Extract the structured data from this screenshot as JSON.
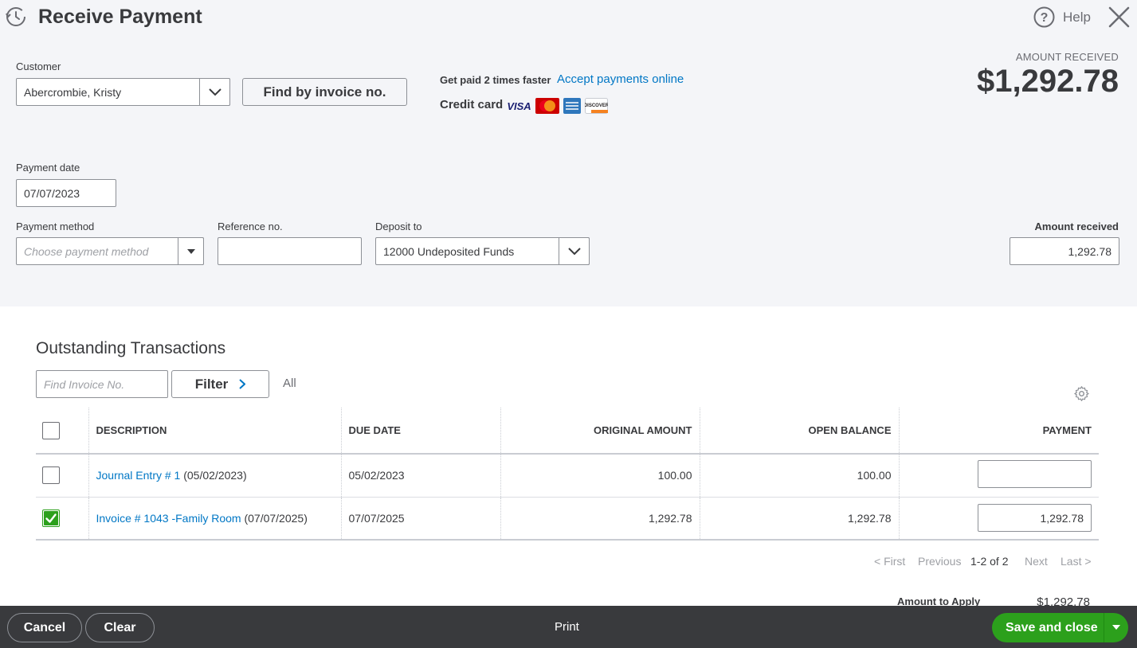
{
  "header": {
    "title": "Receive Payment",
    "help_label": "Help"
  },
  "customer": {
    "label": "Customer",
    "value": "Abercrombie, Kristy",
    "find_button": "Find by invoice no."
  },
  "promo": {
    "text": "Get paid 2 times faster",
    "link": "Accept payments online",
    "credit_label": "Credit card",
    "cards": [
      "visa-icon",
      "mastercard-icon",
      "amex-icon",
      "discover-icon"
    ]
  },
  "amount_received_banner": {
    "caption": "AMOUNT RECEIVED",
    "value": "$1,292.78"
  },
  "payment_date": {
    "label": "Payment date",
    "value": "07/07/2023"
  },
  "payment_method": {
    "label": "Payment method",
    "placeholder": "Choose payment method"
  },
  "reference": {
    "label": "Reference no.",
    "value": ""
  },
  "deposit_to": {
    "label": "Deposit to",
    "value": "12000 Undeposited Funds"
  },
  "amount_received_field": {
    "label": "Amount received",
    "value": "1,292.78"
  },
  "outstanding": {
    "title": "Outstanding Transactions",
    "search_placeholder": "Find Invoice No.",
    "filter_label": "Filter",
    "filter_value": "All",
    "columns": [
      "DESCRIPTION",
      "DUE DATE",
      "ORIGINAL AMOUNT",
      "OPEN BALANCE",
      "PAYMENT"
    ],
    "rows": [
      {
        "checked": false,
        "link": "Journal Entry # 1",
        "suffix": " (05/02/2023)",
        "due_date": "05/02/2023",
        "original": "100.00",
        "open": "100.00",
        "payment": ""
      },
      {
        "checked": true,
        "link": "Invoice # 1043 -Family Room",
        "suffix": " (07/07/2025)",
        "due_date": "07/07/2025",
        "original": "1,292.78",
        "open": "1,292.78",
        "payment": "1,292.78"
      }
    ],
    "pager": {
      "first": "< First",
      "previous": "Previous",
      "range": "1-2 of 2",
      "next": "Next",
      "last": "Last >"
    },
    "amount_to_apply_label": "Amount to Apply",
    "amount_to_apply_value": "$1,292.78"
  },
  "footer": {
    "cancel": "Cancel",
    "clear": "Clear",
    "print": "Print",
    "save": "Save and close"
  },
  "colors": {
    "accent_green": "#2ca01c",
    "link_blue": "#0077c5",
    "footer_bg": "#393a3d",
    "top_bg": "#f4f5f8"
  }
}
